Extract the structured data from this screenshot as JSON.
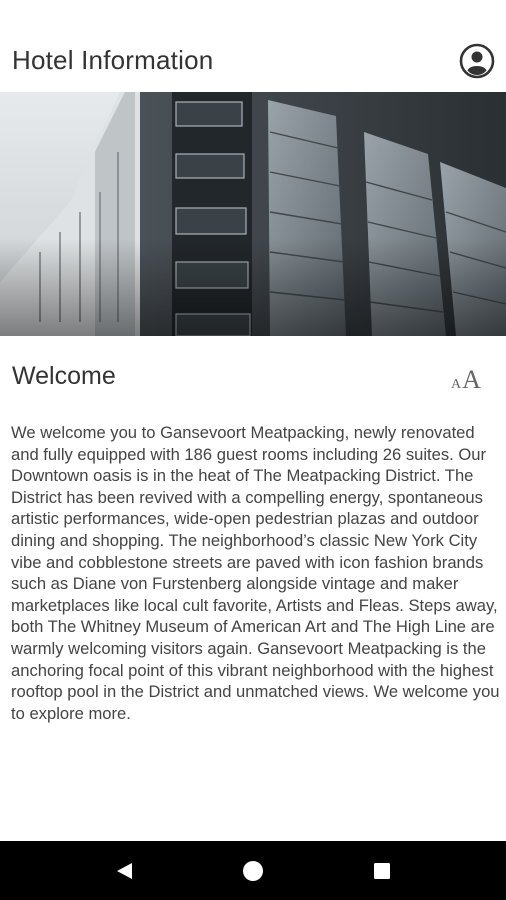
{
  "header": {
    "title": "Hotel Information",
    "profile_icon": "account-circle-icon"
  },
  "hero": {
    "image": "building-facade-photo"
  },
  "content": {
    "title": "Welcome",
    "text_size_icon": "text-size-icon",
    "text_size_small": "A",
    "text_size_large": "A",
    "body": "We welcome you to Gansevoort Meatpacking, newly renovated and fully equipped with 186 guest rooms including 26 suites. Our Downtown oasis is in the heat of The Meatpacking District. The District has been revived with a compelling energy, spontaneous artistic performances, wide-open pedestrian plazas and outdoor dining and shopping. The neighborhood’s classic New York City vibe and cobblestone streets are paved with icon fashion brands such as Diane von Furstenberg alongside vintage and maker marketplaces like local cult favorite, Artists and Fleas.  Steps away, both The Whitney Museum of American Art and The High Line are warmly welcoming visitors again. Gansevoort Meatpacking is the anchoring focal point of this vibrant neighborhood with the highest rooftop pool in the District and unmatched views. We welcome you to explore more."
  },
  "navbar": {
    "back_icon": "back-triangle-icon",
    "home_icon": "home-circle-icon",
    "recents_icon": "recents-square-icon"
  },
  "colors": {
    "text": "#333333",
    "navbar": "#000000",
    "background": "#ffffff"
  }
}
